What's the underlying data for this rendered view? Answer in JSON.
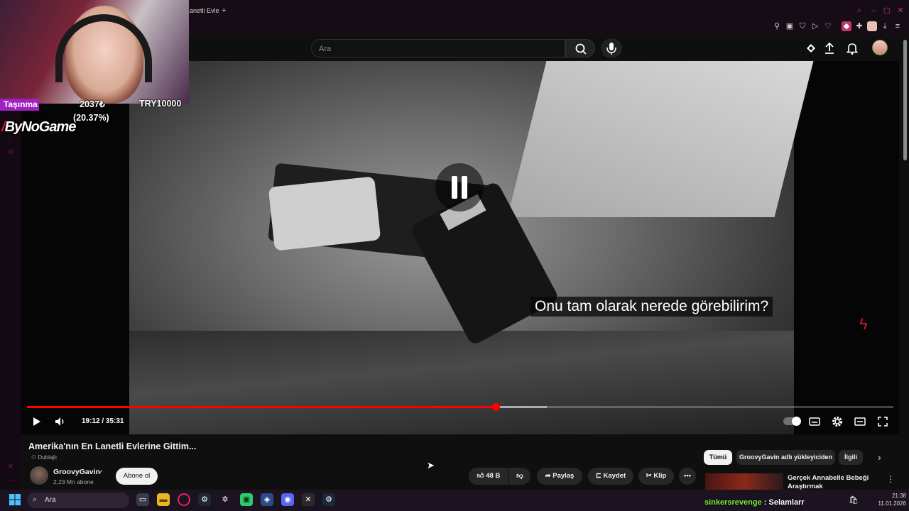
{
  "browser": {
    "tab_title": "Lanetli Evle",
    "new_tab_symbol": "+",
    "extension_icons": [
      "pin-icon",
      "window-icon",
      "shield-icon",
      "play-icon",
      "heart-icon",
      "extension-icon",
      "puzzle-icon",
      "profile-icon",
      "download-icon",
      "menu-icon"
    ],
    "accent_color": "#c0386a"
  },
  "search": {
    "placeholder": "Ara"
  },
  "player": {
    "subtitle": "Onu tam olarak nerede görebilirim?",
    "time_display": "19:12 / 35:31",
    "progress_played_fraction": 0.5407,
    "progress_buffered_fraction": 0.6,
    "state": "paused",
    "progress_color": "#ff0000"
  },
  "video": {
    "title": "Amerika'nın En Lanetli Evlerine Gittim...",
    "dub_label": "Dublajlı",
    "channel_name": "GroovyGavin",
    "subscribers": "2,23 Mn abone",
    "subscribe_label": "Abone ol",
    "likes": "48 B",
    "share_label": "Paylaş",
    "save_label": "Kaydet",
    "clip_label": "Klip",
    "more_symbol": "•••"
  },
  "recommendations": {
    "chips": [
      "Tümü",
      "GroovyGavin adlı yükleyiciden",
      "İlgili"
    ],
    "first_title": "Gerçek Annabelle Bebeği Araştırmak"
  },
  "stream_overlay": {
    "label": "Taşınma",
    "amount": "2037₺",
    "percent": "(20.37%)",
    "goal": "TRY10000",
    "logo_text": "ByNoGame"
  },
  "taskbar": {
    "search_label": "Ara",
    "chat_user": "sinkersrevenge",
    "chat_separator": " : ",
    "chat_message": "Selamlarr",
    "time": "21:38",
    "date": "11.01.2026"
  }
}
